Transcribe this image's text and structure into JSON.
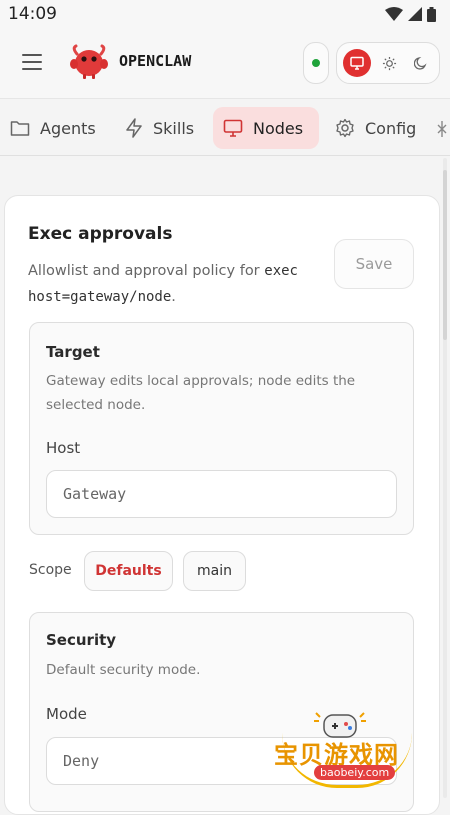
{
  "status": {
    "time": "14:09"
  },
  "header": {
    "brand": "OPENCLAW"
  },
  "tabs": [
    {
      "label": "Agents",
      "icon": "folder-icon",
      "active": false
    },
    {
      "label": "Skills",
      "icon": "zap-icon",
      "active": false
    },
    {
      "label": "Nodes",
      "icon": "monitor-icon",
      "active": true
    },
    {
      "label": "Config",
      "icon": "gear-icon",
      "active": false
    }
  ],
  "theme": {
    "active": "monitor",
    "accent": "#e03030"
  },
  "connection": {
    "status_color": "#1fa33a"
  },
  "exec": {
    "title": "Exec approvals",
    "desc_text": "Allowlist and approval policy for",
    "desc_code_1": "exec",
    "desc_code_2": "host=gateway/node",
    "desc_suffix": ".",
    "save_label": "Save"
  },
  "target": {
    "title": "Target",
    "desc": "Gateway edits local approvals; node edits the selected node.",
    "host_label": "Host",
    "host_value": "Gateway"
  },
  "scope": {
    "label": "Scope",
    "options": [
      {
        "label": "Defaults",
        "active": true
      },
      {
        "label": "main",
        "active": false
      }
    ]
  },
  "security": {
    "title": "Security",
    "desc": "Default security mode.",
    "mode_label": "Mode",
    "mode_value": "Deny"
  },
  "watermark": {
    "cn": "宝贝游戏网",
    "url": "baobeiy.com"
  }
}
